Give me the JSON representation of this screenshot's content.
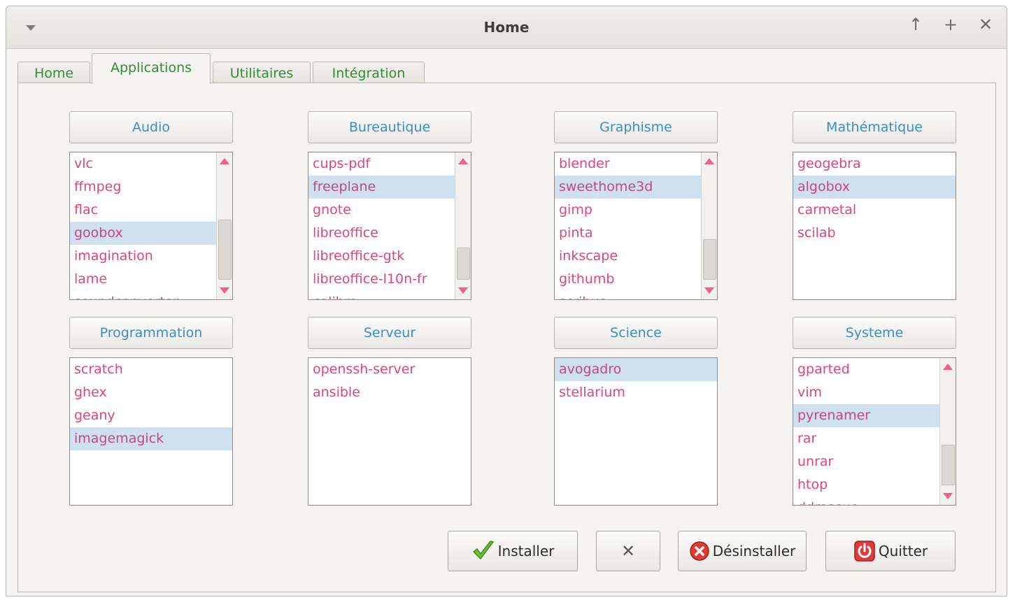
{
  "window": {
    "title": "Home"
  },
  "tabs": [
    "Home",
    "Applications",
    "Utilitaires",
    "Intégration"
  ],
  "categories": [
    {
      "label": "Audio",
      "items": [
        "vlc",
        "ffmpeg",
        "flac",
        "goobox",
        "imagination",
        "lame",
        "soundconverter"
      ]
    },
    {
      "label": "Bureautique",
      "items": [
        "cups-pdf",
        "freeplane",
        "gnote",
        "libreoffice",
        "libreoffice-gtk",
        "libreoffice-l10n-fr",
        "calibre"
      ]
    },
    {
      "label": "Graphisme",
      "items": [
        "blender",
        "sweethome3d",
        "gimp",
        "pinta",
        "inkscape",
        "githumb",
        "scribus"
      ]
    },
    {
      "label": "Mathématique",
      "items": [
        "geogebra",
        "algobox",
        "carmetal",
        "scilab"
      ]
    },
    {
      "label": "Programmation",
      "items": [
        "scratch",
        "ghex",
        "geany",
        "imagemagick"
      ]
    },
    {
      "label": "Serveur",
      "items": [
        "openssh-server",
        "ansible"
      ]
    },
    {
      "label": "Science",
      "items": [
        "avogadro",
        "stellarium"
      ]
    },
    {
      "label": "Systeme",
      "items": [
        "gparted",
        "vim",
        "pyrenamer",
        "rar",
        "unrar",
        "htop",
        "ddrescue"
      ]
    }
  ],
  "actions": {
    "install": "Installer",
    "cancel": "✕",
    "uninstall": "Désinstaller",
    "quit": "Quitter"
  },
  "colors": {
    "tab_text": "#2f8f2f",
    "category_text": "#3a8ec4",
    "item_text": "#e0457a",
    "selection": "#cfe0ee"
  }
}
